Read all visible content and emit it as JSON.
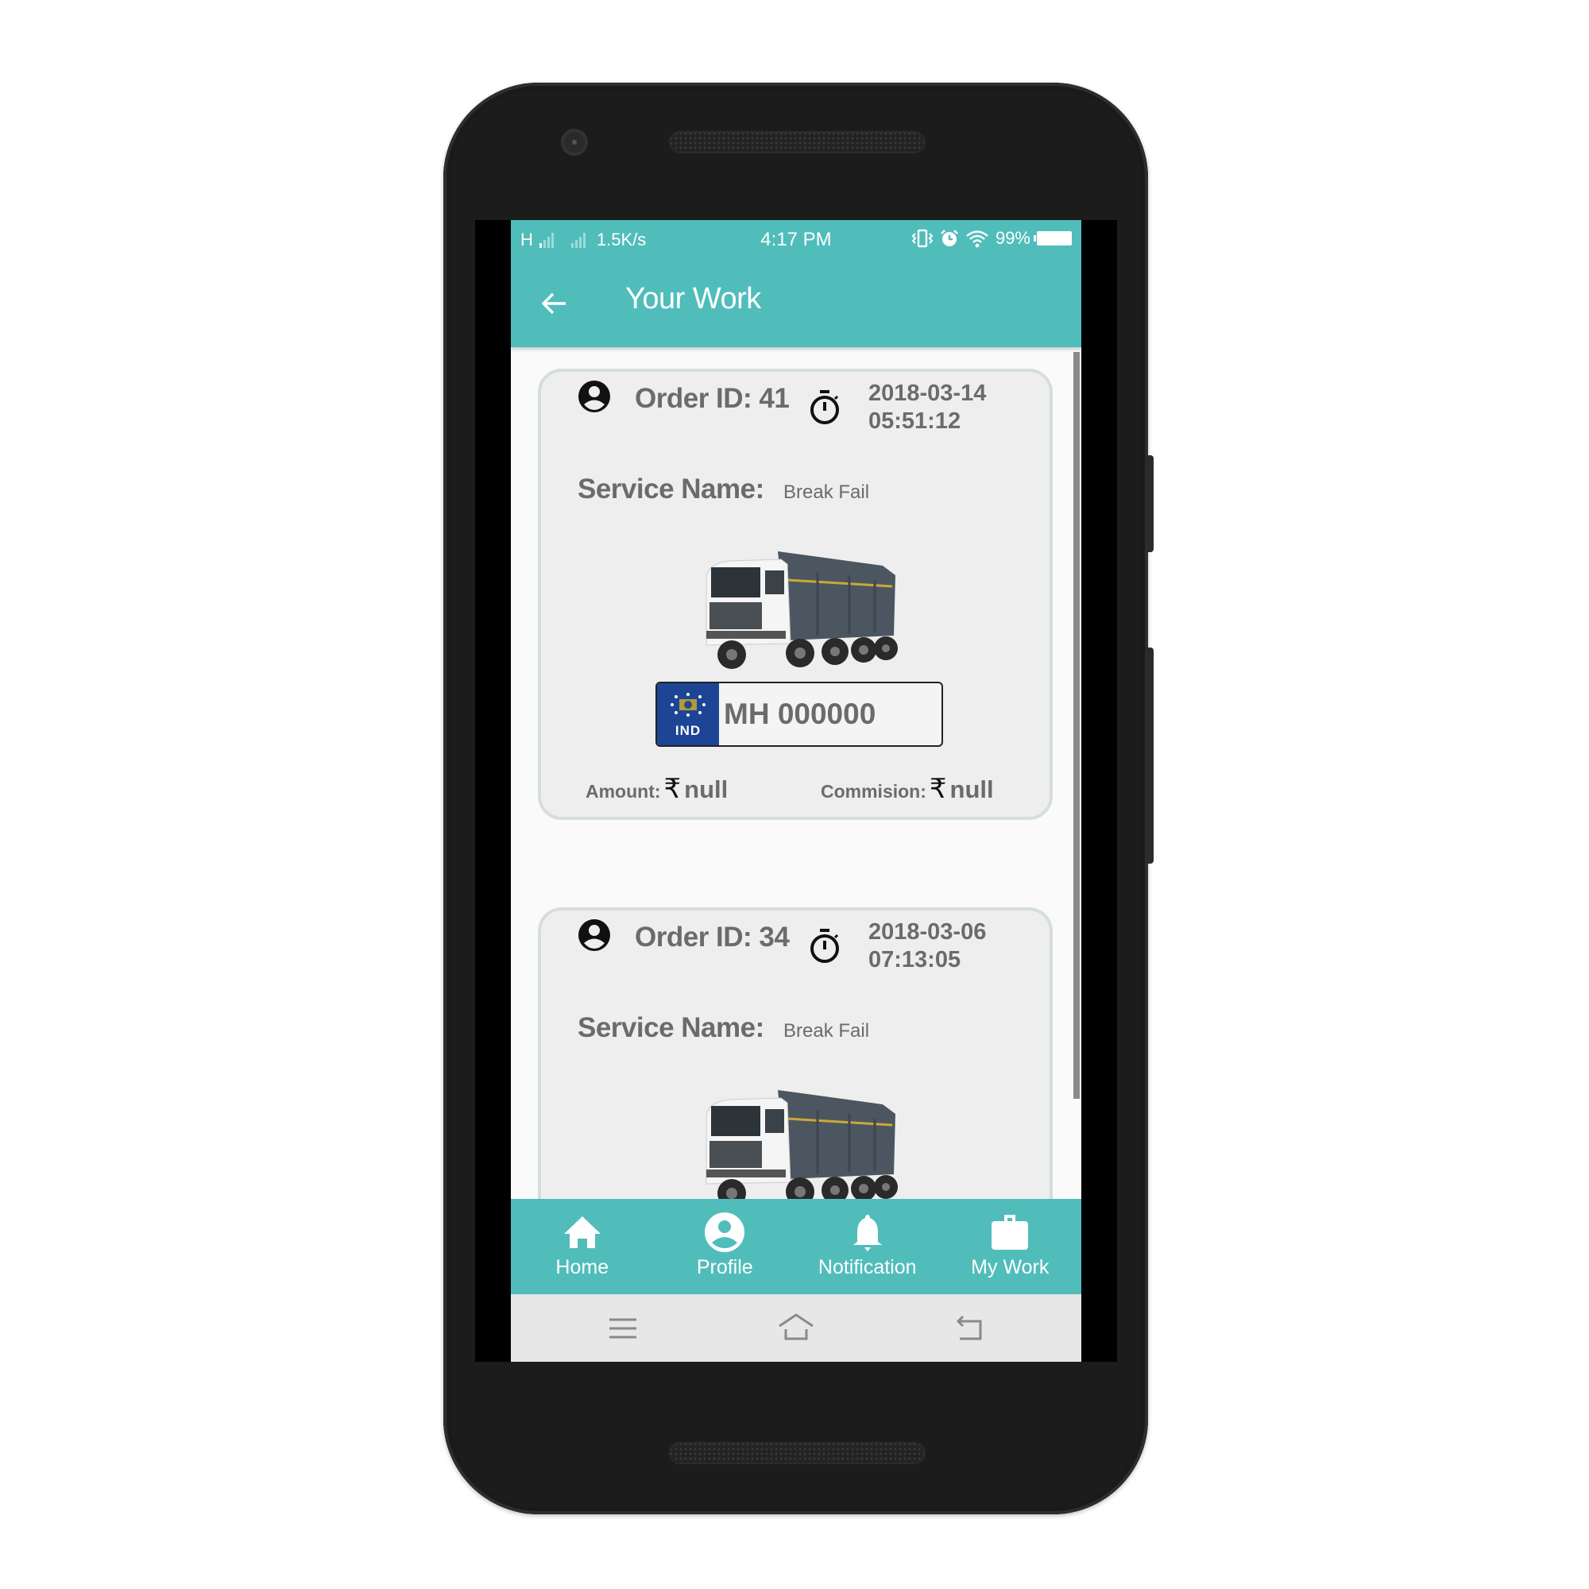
{
  "status_bar": {
    "network_type": "H",
    "data_speed": "1.5K/s",
    "time": "4:17 PM",
    "battery_percent": "99%",
    "icons": [
      "signal-icon",
      "signal-icon",
      "vibrate-icon",
      "alarm-icon",
      "wifi-icon",
      "battery-icon"
    ]
  },
  "app_bar": {
    "back_icon": "arrow-left-icon",
    "title": "Your Work"
  },
  "orders": [
    {
      "order_label": "Order ID: 41",
      "date": "2018-03-14",
      "time": "05:51:12",
      "service_label": "Service Name:",
      "service_value": "Break Fail",
      "vehicle_image": "dump-truck",
      "plate_country": "IND",
      "plate_number": "MH 000000",
      "amount_label": "Amount:",
      "amount_currency": "₹",
      "amount_value": "null",
      "commission_label": "Commision:",
      "commission_currency": "₹",
      "commission_value": "null"
    },
    {
      "order_label": "Order ID: 34",
      "date": "2018-03-06",
      "time": "07:13:05",
      "service_label": "Service Name:",
      "service_value": "Break Fail",
      "vehicle_image": "dump-truck"
    }
  ],
  "bottom_nav": [
    {
      "label": "Home",
      "icon": "home-icon"
    },
    {
      "label": "Profile",
      "icon": "profile-icon"
    },
    {
      "label": "Notification",
      "icon": "bell-icon"
    },
    {
      "label": "My Work",
      "icon": "briefcase-icon"
    }
  ],
  "system_nav": [
    "menu-icon",
    "home-outline-icon",
    "back-icon"
  ],
  "colors": {
    "primary": "#50bdbb",
    "card_bg": "#eeeeee",
    "card_border": "#d6dde0",
    "text_gray": "#6b6b6b",
    "plate_blue": "#1d4596"
  }
}
